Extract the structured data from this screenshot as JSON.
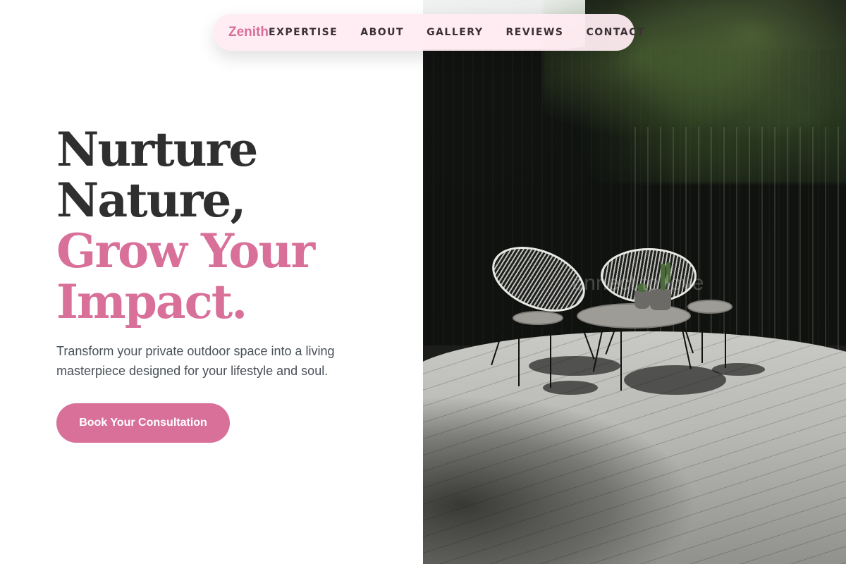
{
  "brand": {
    "name": "Zenith",
    "color": "#d8709a"
  },
  "nav": {
    "items": [
      {
        "label": "EXPERTISE"
      },
      {
        "label": "ABOUT"
      },
      {
        "label": "GALLERY"
      },
      {
        "label": "REVIEWS"
      },
      {
        "label": "CONTACT"
      }
    ]
  },
  "hero": {
    "title_line1": "Nurture",
    "title_line2": "Nature,",
    "title_line3": "Grow Your",
    "title_line4": "Impact.",
    "subtitle": "Transform your private outdoor space into a living masterpiece designed for your lifestyle and soul.",
    "cta_label": "Book Your Consultation"
  },
  "photo": {
    "watermark": "onnect to love"
  },
  "colors": {
    "accent": "#d8709a",
    "heading": "#2f2f2f",
    "body_text": "#4a5058",
    "nav_bg": "#ffecf2"
  }
}
